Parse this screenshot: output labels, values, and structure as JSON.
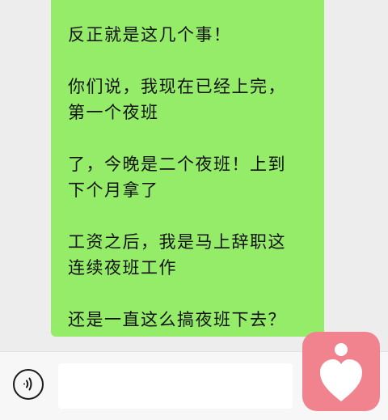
{
  "message": {
    "lines": [
      "反正就是这几个事！",
      "",
      "你们说，我现在已经上完，",
      "第一个夜班",
      "",
      "了，今晚是二个夜班！上到",
      "下个月拿了",
      "",
      "工资之后，我是马上辞职这",
      "连续夜班工作",
      "",
      "还是一直这么搞夜班下去？"
    ],
    "bubble_color": "#95ec69"
  },
  "input_bar": {
    "voice_icon": "voice-icon",
    "text_value": ""
  },
  "watermark": {
    "icon": "heart-logo-icon",
    "color": "#f0838d"
  }
}
